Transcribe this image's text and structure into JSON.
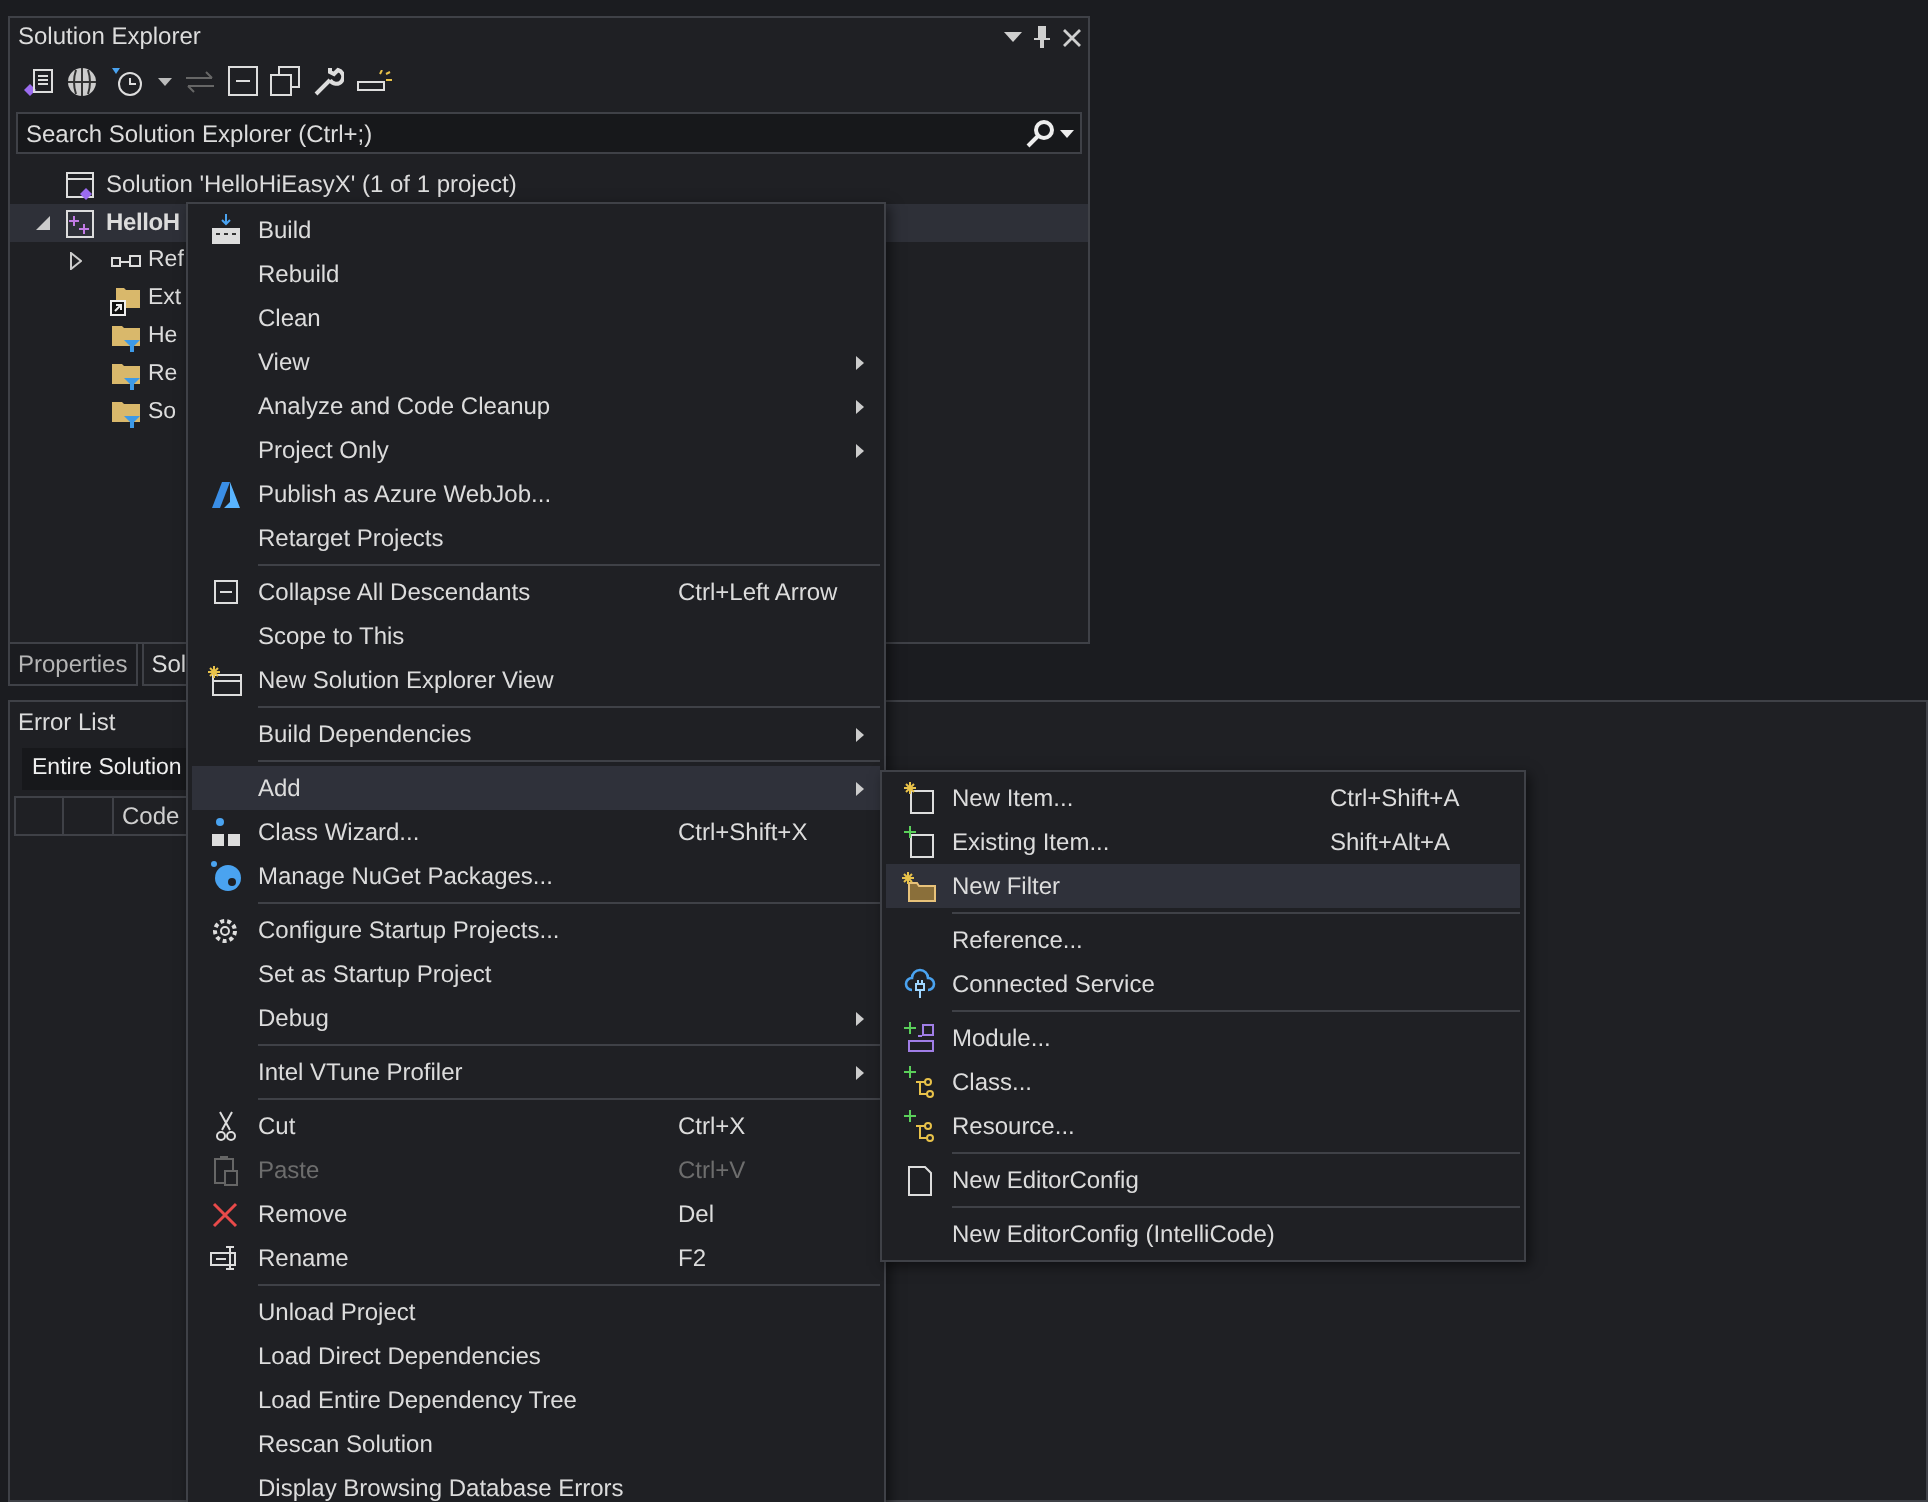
{
  "solution_explorer": {
    "title": "Solution Explorer",
    "search": {
      "placeholder": "Search Solution Explorer (Ctrl+;)"
    },
    "tree": [
      {
        "label": "Solution 'HelloHiEasyX' (1 of 1 project)",
        "selected": false,
        "children": [
          {
            "label": "HelloH",
            "selected": true,
            "expanded": true,
            "children": [
              {
                "label": "Ref",
                "selected": false,
                "expanded": false
              },
              {
                "label": "Ext",
                "selected": false
              },
              {
                "label": "He",
                "selected": false
              },
              {
                "label": "Re",
                "selected": false
              },
              {
                "label": "So",
                "selected": false
              }
            ]
          }
        ]
      }
    ]
  },
  "panel_tabs": [
    {
      "label": "Properties",
      "selected": false
    },
    {
      "label": "Sol",
      "selected": true
    }
  ],
  "error_list": {
    "title": "Error List",
    "scope": "Entire Solution",
    "columns": [
      "",
      "",
      "Code"
    ]
  },
  "context_menu": {
    "items": [
      {
        "kind": "item",
        "label": "Build",
        "selected": false,
        "disabled": false,
        "submenu": false
      },
      {
        "kind": "item",
        "label": "Rebuild",
        "selected": false,
        "disabled": false,
        "submenu": false
      },
      {
        "kind": "item",
        "label": "Clean",
        "selected": false,
        "disabled": false,
        "submenu": false
      },
      {
        "kind": "item",
        "label": "View",
        "selected": false,
        "disabled": false,
        "submenu": true
      },
      {
        "kind": "item",
        "label": "Analyze and Code Cleanup",
        "selected": false,
        "disabled": false,
        "submenu": true
      },
      {
        "kind": "item",
        "label": "Project Only",
        "selected": false,
        "disabled": false,
        "submenu": true
      },
      {
        "kind": "item",
        "label": "Publish as Azure WebJob...",
        "selected": false,
        "disabled": false,
        "submenu": false
      },
      {
        "kind": "item",
        "label": "Retarget Projects",
        "selected": false,
        "disabled": false,
        "submenu": false
      },
      {
        "kind": "separator"
      },
      {
        "kind": "item",
        "label": "Collapse All Descendants",
        "shortcut": "Ctrl+Left Arrow",
        "selected": false,
        "disabled": false,
        "submenu": false
      },
      {
        "kind": "item",
        "label": "Scope to This",
        "selected": false,
        "disabled": false,
        "submenu": false
      },
      {
        "kind": "item",
        "label": "New Solution Explorer View",
        "selected": false,
        "disabled": false,
        "submenu": false
      },
      {
        "kind": "separator"
      },
      {
        "kind": "item",
        "label": "Build Dependencies",
        "selected": false,
        "disabled": false,
        "submenu": true
      },
      {
        "kind": "separator"
      },
      {
        "kind": "item",
        "label": "Add",
        "selected": true,
        "disabled": false,
        "submenu": true
      },
      {
        "kind": "item",
        "label": "Class Wizard...",
        "shortcut": "Ctrl+Shift+X",
        "selected": false,
        "disabled": false,
        "submenu": false
      },
      {
        "kind": "item",
        "label": "Manage NuGet Packages...",
        "selected": false,
        "disabled": false,
        "submenu": false
      },
      {
        "kind": "separator"
      },
      {
        "kind": "item",
        "label": "Configure Startup Projects...",
        "selected": false,
        "disabled": false,
        "submenu": false
      },
      {
        "kind": "item",
        "label": "Set as Startup Project",
        "selected": false,
        "disabled": false,
        "submenu": false
      },
      {
        "kind": "item",
        "label": "Debug",
        "selected": false,
        "disabled": false,
        "submenu": true
      },
      {
        "kind": "separator"
      },
      {
        "kind": "item",
        "label": "Intel VTune Profiler",
        "selected": false,
        "disabled": false,
        "submenu": true
      },
      {
        "kind": "separator"
      },
      {
        "kind": "item",
        "label": "Cut",
        "shortcut": "Ctrl+X",
        "selected": false,
        "disabled": false,
        "submenu": false
      },
      {
        "kind": "item",
        "label": "Paste",
        "shortcut": "Ctrl+V",
        "selected": false,
        "disabled": true,
        "submenu": false
      },
      {
        "kind": "item",
        "label": "Remove",
        "shortcut": "Del",
        "selected": false,
        "disabled": false,
        "submenu": false
      },
      {
        "kind": "item",
        "label": "Rename",
        "shortcut": "F2",
        "selected": false,
        "disabled": false,
        "submenu": false
      },
      {
        "kind": "separator"
      },
      {
        "kind": "item",
        "label": "Unload Project",
        "selected": false,
        "disabled": false,
        "submenu": false
      },
      {
        "kind": "item",
        "label": "Load Direct Dependencies",
        "selected": false,
        "disabled": false,
        "submenu": false
      },
      {
        "kind": "item",
        "label": "Load Entire Dependency Tree",
        "selected": false,
        "disabled": false,
        "submenu": false
      },
      {
        "kind": "item",
        "label": "Rescan Solution",
        "selected": false,
        "disabled": false,
        "submenu": false
      },
      {
        "kind": "item",
        "label": "Display Browsing Database Errors",
        "selected": false,
        "disabled": false,
        "submenu": false
      }
    ]
  },
  "add_submenu": {
    "items": [
      {
        "kind": "item",
        "label": "New Item...",
        "shortcut": "Ctrl+Shift+A",
        "selected": false,
        "disabled": false,
        "submenu": false
      },
      {
        "kind": "item",
        "label": "Existing Item...",
        "shortcut": "Shift+Alt+A",
        "selected": false,
        "disabled": false,
        "submenu": false
      },
      {
        "kind": "item",
        "label": "New Filter",
        "selected": true,
        "disabled": false,
        "submenu": false
      },
      {
        "kind": "separator"
      },
      {
        "kind": "item",
        "label": "Reference...",
        "selected": false,
        "disabled": false,
        "submenu": false
      },
      {
        "kind": "item",
        "label": "Connected Service",
        "selected": false,
        "disabled": false,
        "submenu": false
      },
      {
        "kind": "separator"
      },
      {
        "kind": "item",
        "label": "Module...",
        "selected": false,
        "disabled": false,
        "submenu": false
      },
      {
        "kind": "item",
        "label": "Class...",
        "selected": false,
        "disabled": false,
        "submenu": false
      },
      {
        "kind": "item",
        "label": "Resource...",
        "selected": false,
        "disabled": false,
        "submenu": false
      },
      {
        "kind": "separator"
      },
      {
        "kind": "item",
        "label": "New EditorConfig",
        "selected": false,
        "disabled": false,
        "submenu": false
      },
      {
        "kind": "separator"
      },
      {
        "kind": "item",
        "label": "New EditorConfig (IntelliCode)",
        "selected": false,
        "disabled": false,
        "submenu": false
      }
    ]
  }
}
